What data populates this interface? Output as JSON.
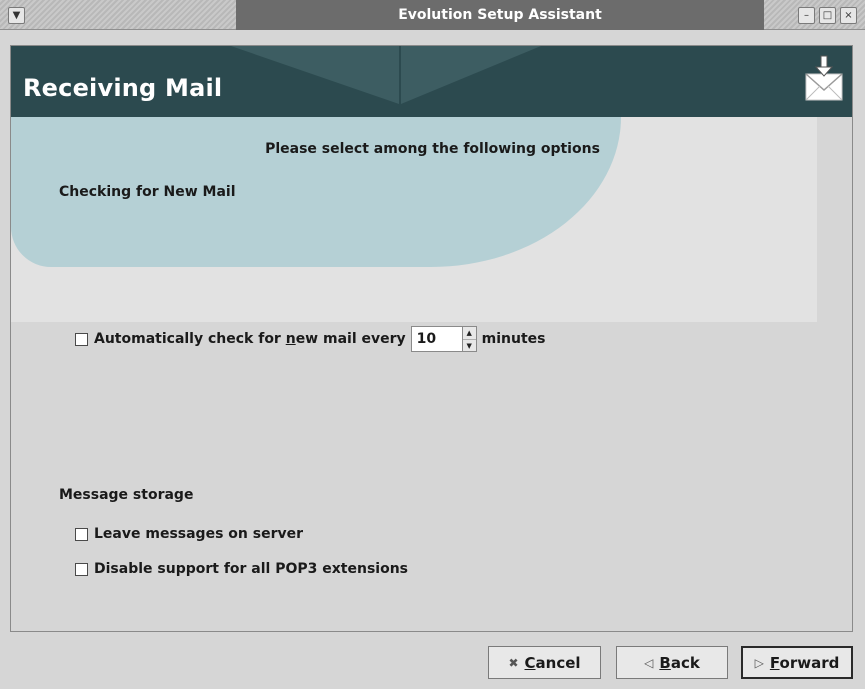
{
  "window": {
    "title": "Evolution Setup Assistant",
    "menu_icon": "chevron-down-icon",
    "minimize_icon": "minimize-icon",
    "maximize_icon": "maximize-icon",
    "close_icon": "close-icon"
  },
  "page": {
    "heading": "Receiving Mail",
    "heading_icon": "mail-download-icon",
    "subtitle": "Please select among the following options"
  },
  "checking": {
    "section_title": "Checking for New Mail",
    "auto_check": {
      "label_before": "Automatically check for ",
      "label_mnemonic": "n",
      "label_after": "ew mail every",
      "checked": false,
      "value": "10",
      "unit": "minutes"
    }
  },
  "storage": {
    "section_title": "Message storage",
    "leave_on_server": {
      "label": "Leave messages on server",
      "checked": false
    },
    "disable_pop3_ext": {
      "label": "Disable support for all POP3 extensions",
      "checked": false
    }
  },
  "buttons": {
    "cancel": {
      "mnemonic": "C",
      "rest": "ancel",
      "icon": "cancel-x-icon"
    },
    "back": {
      "mnemonic": "B",
      "rest": "ack",
      "icon": "back-arrow-icon"
    },
    "forward": {
      "mnemonic": "F",
      "rest": "orward",
      "icon": "forward-arrow-icon"
    }
  },
  "colors": {
    "banner": "#2c4a4f",
    "accent_blob": "#b5d0d5",
    "background": "#d6d6d6"
  }
}
